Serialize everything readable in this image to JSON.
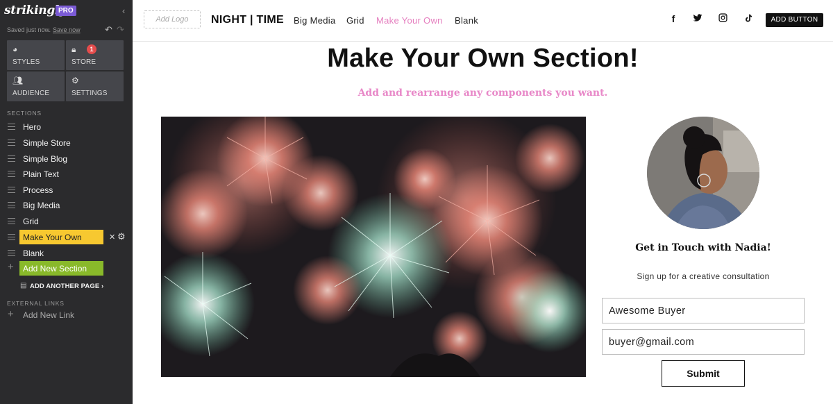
{
  "sidebar": {
    "brand": "strikingly",
    "pro_badge": "PRO",
    "saved_text": "Saved just now.",
    "save_now": "Save now",
    "tiles": [
      {
        "label": "STYLES",
        "icon": "palette-icon"
      },
      {
        "label": "STORE",
        "icon": "bag-icon",
        "badge": "1"
      },
      {
        "label": "AUDIENCE",
        "icon": "people-icon"
      },
      {
        "label": "SETTINGS",
        "icon": "gear-icon"
      }
    ],
    "sections_heading": "SECTIONS",
    "sections": [
      "Hero",
      "Simple Store",
      "Simple Blog",
      "Plain Text",
      "Process",
      "Big Media",
      "Grid",
      "Make Your Own",
      "Blank"
    ],
    "active_section": "Make Your Own",
    "add_section": "Add New Section",
    "add_page": "ADD ANOTHER PAGE",
    "external_heading": "EXTERNAL LINKS",
    "add_link": "Add New Link"
  },
  "navbar": {
    "add_logo": "Add Logo",
    "site_title": "NIGHT | TIME",
    "links": [
      "Big Media",
      "Grid",
      "Make Your Own",
      "Blank"
    ],
    "current_link": "Make Your Own",
    "social_icons": [
      "facebook-icon",
      "twitter-icon",
      "instagram-icon",
      "tiktok-icon"
    ],
    "add_button": "ADD BUTTON"
  },
  "content": {
    "heading": "Make Your Own Section!",
    "subheading": "Add and rearrange any components you want.",
    "contact_title": "Get in Touch with Nadia!",
    "contact_subtitle": "Sign up for a creative consultation",
    "name_value": "Awesome Buyer",
    "email_value": "buyer@gmail.com",
    "submit": "Submit"
  },
  "colors": {
    "sidebar_bg": "#2b2b2d",
    "active_section": "#f7c830",
    "add_section": "#89b92a",
    "accent_pink": "#e57fbf",
    "pro_purple": "#7b5bd6"
  }
}
